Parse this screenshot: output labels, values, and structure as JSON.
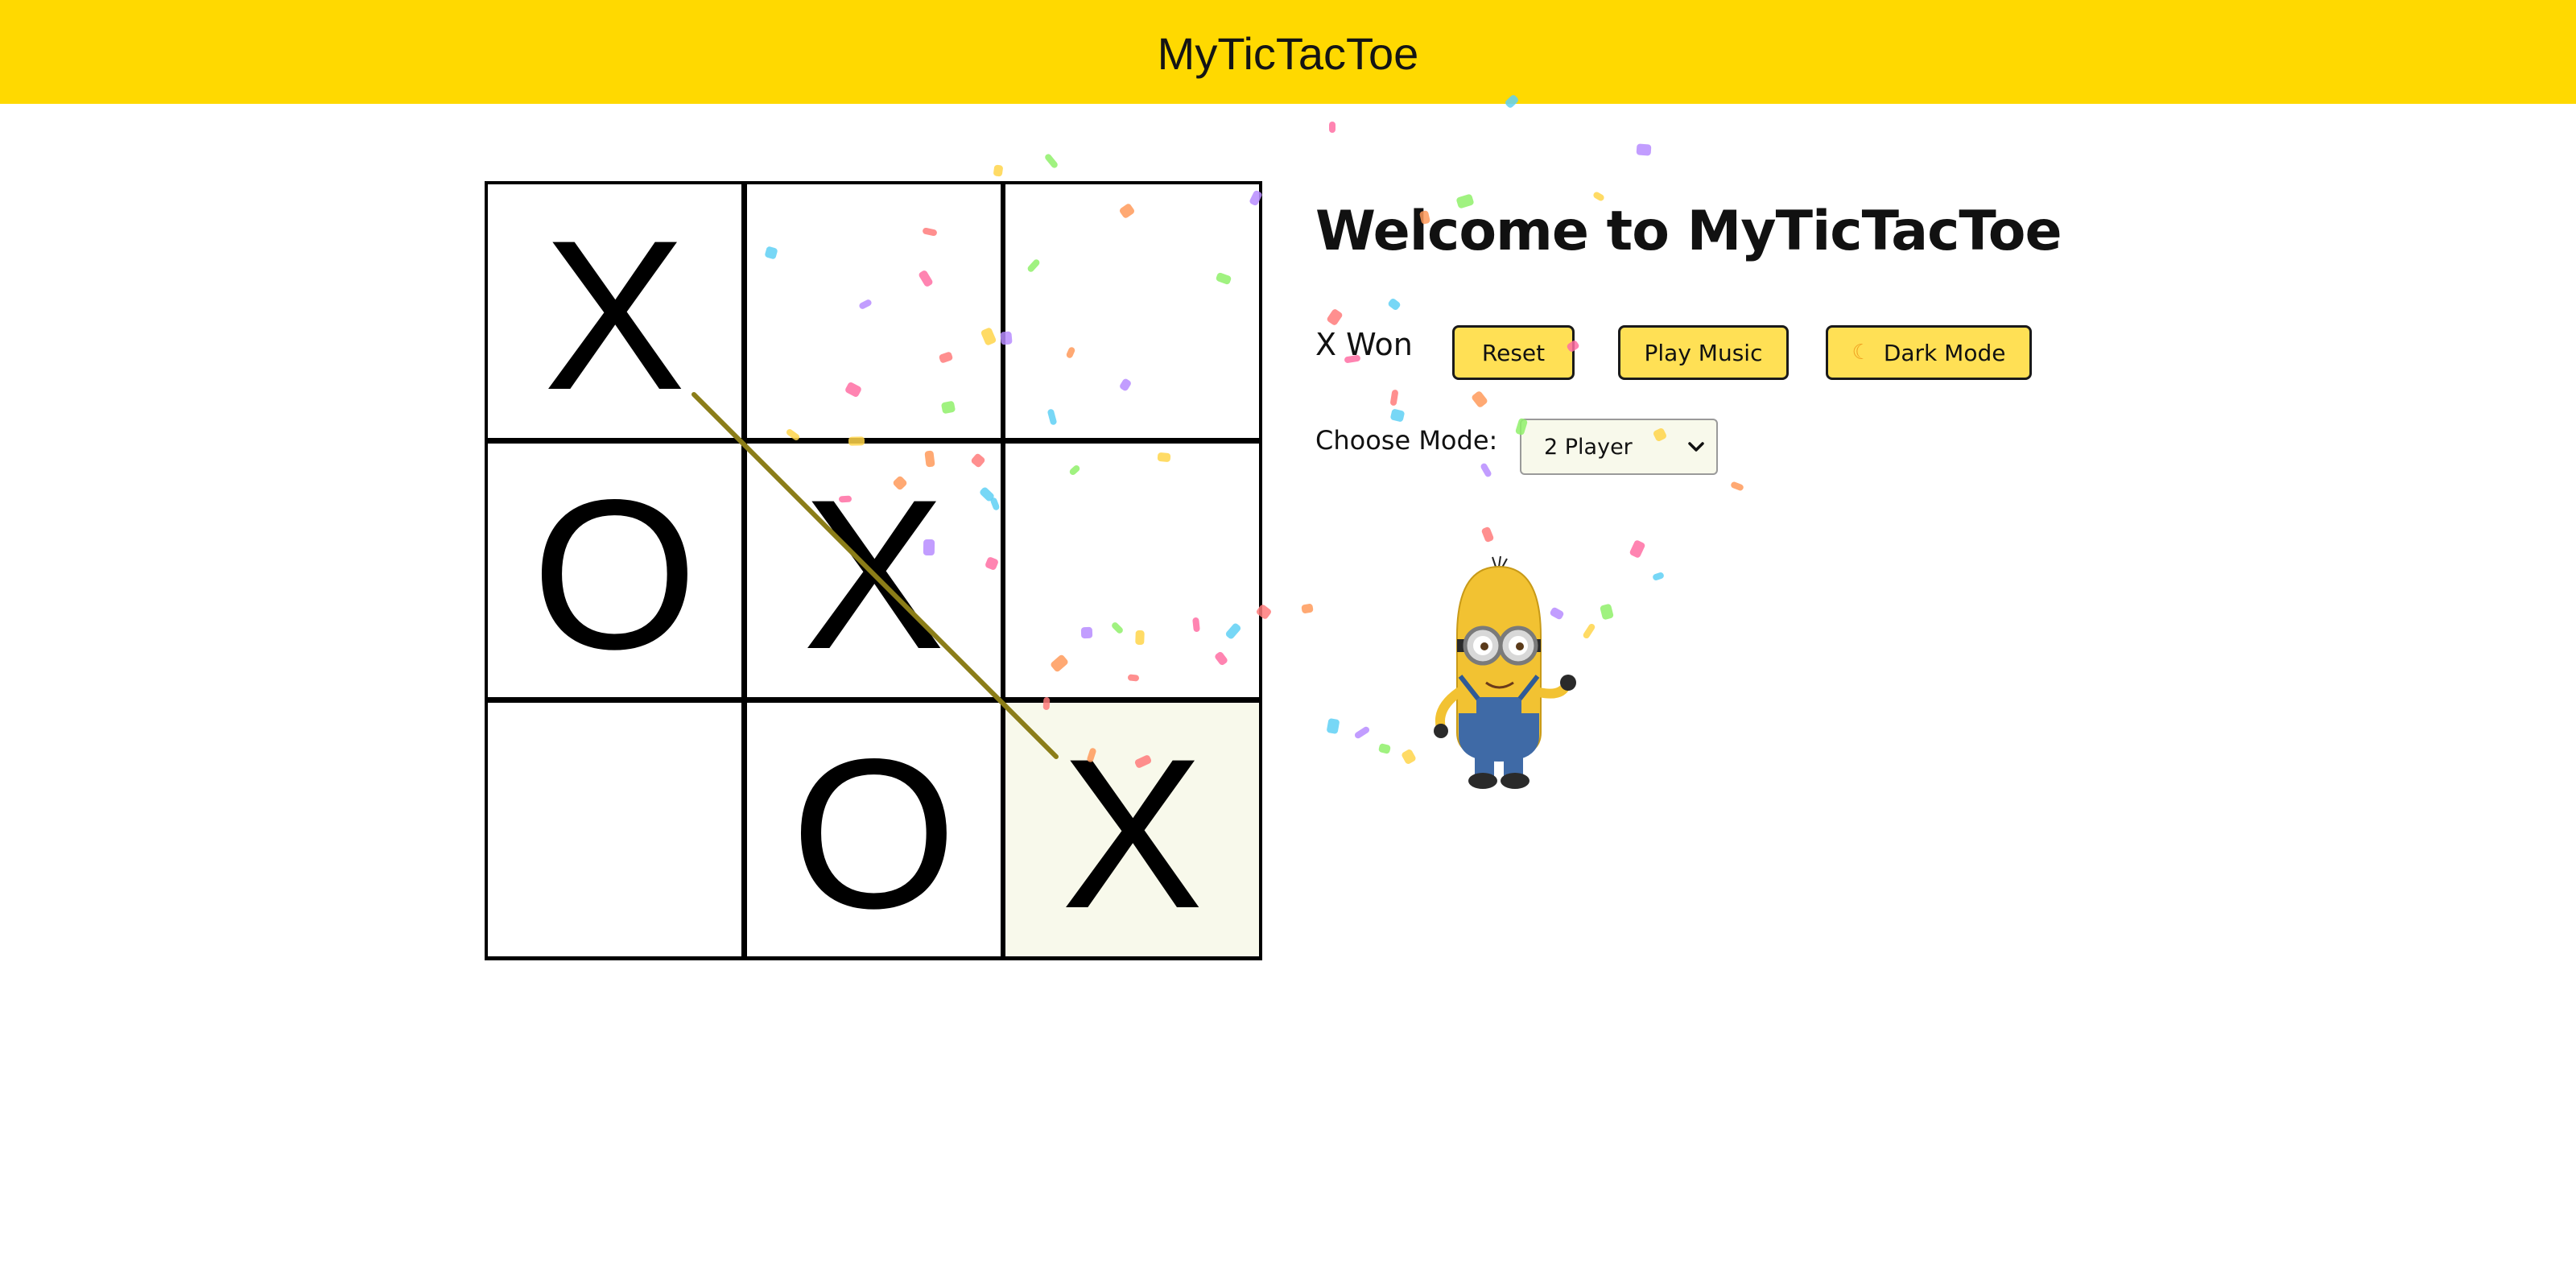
{
  "app": {
    "brand": "MyTicTacToe"
  },
  "board": {
    "cells": [
      "X",
      "",
      "",
      "O",
      "X",
      "",
      "",
      "O",
      "X"
    ],
    "winning_line": [
      0,
      4,
      8
    ],
    "highlighted_cell": 8
  },
  "main": {
    "heading": "Welcome to MyTicTacToe",
    "status": "X Won"
  },
  "controls": {
    "reset_label": "Reset",
    "music_label": "Play Music",
    "dark_label": "Dark Mode",
    "dark_icon": "moon-icon"
  },
  "mode": {
    "label": "Choose Mode:",
    "selected": "2 Player"
  },
  "colors": {
    "navbar": "#ffd900",
    "button": "#ffe055",
    "win_line": "#8b7d18",
    "highlight": "#f8f9eb"
  }
}
